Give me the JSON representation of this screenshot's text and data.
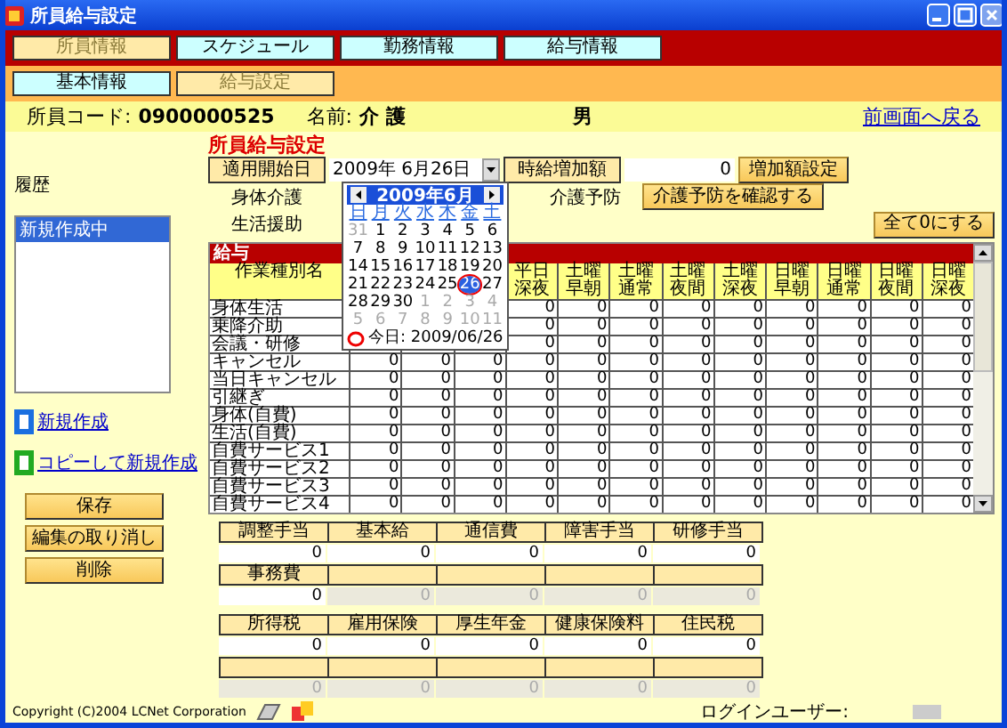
{
  "window": {
    "title": "所員給与設定"
  },
  "main_tabs": [
    {
      "label": "所員情報",
      "selected": true
    },
    {
      "label": "スケジュール",
      "selected": false
    },
    {
      "label": "勤務情報",
      "selected": false
    },
    {
      "label": "給与情報",
      "selected": false
    }
  ],
  "sub_tabs": [
    {
      "label": "基本情報",
      "selected": false
    },
    {
      "label": "給与設定",
      "selected": true
    }
  ],
  "employee": {
    "code_label": "所員コード:",
    "code": "0900000525",
    "name_label": "名前:",
    "name": "介 護",
    "gender": "男",
    "back_link": "前画面へ戻る"
  },
  "history": {
    "label": "履歴",
    "items": [
      {
        "label": "新規作成中",
        "selected": true
      }
    ]
  },
  "actions": [
    {
      "label": "新規作成",
      "kind": "new"
    },
    {
      "label": "コピーして新規作成",
      "kind": "copy"
    }
  ],
  "buttons": [
    "保存",
    "編集の取り消し",
    "削除"
  ],
  "form": {
    "title": "所員給与設定",
    "start_date_label": "適用開始日",
    "start_date": "2009年 6月26日",
    "hourly_label": "時給増加額",
    "hourly_value": "0",
    "hourly_button": "増加額設定",
    "care_label": "身体介護",
    "prevention_label": "介護予防",
    "prevention_button": "介護予防を確認する",
    "life_label": "生活援助",
    "zero_button": "全て0にする"
  },
  "calendar": {
    "month": "2009年6月",
    "weekdays": [
      "日",
      "月",
      "火",
      "水",
      "木",
      "金",
      "土"
    ],
    "weeks": [
      [
        {
          "day": "31",
          "current": false,
          "selected": false
        },
        {
          "day": "1",
          "current": true,
          "selected": false
        },
        {
          "day": "2",
          "current": true,
          "selected": false
        },
        {
          "day": "3",
          "current": true,
          "selected": false
        },
        {
          "day": "4",
          "current": true,
          "selected": false
        },
        {
          "day": "5",
          "current": true,
          "selected": false
        },
        {
          "day": "6",
          "current": true,
          "selected": false
        }
      ],
      [
        {
          "day": "7",
          "current": true,
          "selected": false
        },
        {
          "day": "8",
          "current": true,
          "selected": false
        },
        {
          "day": "9",
          "current": true,
          "selected": false
        },
        {
          "day": "10",
          "current": true,
          "selected": false
        },
        {
          "day": "11",
          "current": true,
          "selected": false
        },
        {
          "day": "12",
          "current": true,
          "selected": false
        },
        {
          "day": "13",
          "current": true,
          "selected": false
        }
      ],
      [
        {
          "day": "14",
          "current": true,
          "selected": false
        },
        {
          "day": "15",
          "current": true,
          "selected": false
        },
        {
          "day": "16",
          "current": true,
          "selected": false
        },
        {
          "day": "17",
          "current": true,
          "selected": false
        },
        {
          "day": "18",
          "current": true,
          "selected": false
        },
        {
          "day": "19",
          "current": true,
          "selected": false
        },
        {
          "day": "20",
          "current": true,
          "selected": false
        }
      ],
      [
        {
          "day": "21",
          "current": true,
          "selected": false
        },
        {
          "day": "22",
          "current": true,
          "selected": false
        },
        {
          "day": "23",
          "current": true,
          "selected": false
        },
        {
          "day": "24",
          "current": true,
          "selected": false
        },
        {
          "day": "25",
          "current": true,
          "selected": false
        },
        {
          "day": "26",
          "current": true,
          "selected": true
        },
        {
          "day": "27",
          "current": true,
          "selected": false
        }
      ],
      [
        {
          "day": "28",
          "current": true,
          "selected": false
        },
        {
          "day": "29",
          "current": true,
          "selected": false
        },
        {
          "day": "30",
          "current": true,
          "selected": false
        },
        {
          "day": "1",
          "current": false,
          "selected": false
        },
        {
          "day": "2",
          "current": false,
          "selected": false
        },
        {
          "day": "3",
          "current": false,
          "selected": false
        },
        {
          "day": "4",
          "current": false,
          "selected": false
        }
      ],
      [
        {
          "day": "5",
          "current": false,
          "selected": false
        },
        {
          "day": "6",
          "current": false,
          "selected": false
        },
        {
          "day": "7",
          "current": false,
          "selected": false
        },
        {
          "day": "8",
          "current": false,
          "selected": false
        },
        {
          "day": "9",
          "current": false,
          "selected": false
        },
        {
          "day": "10",
          "current": false,
          "selected": false
        },
        {
          "day": "11",
          "current": false,
          "selected": false
        }
      ]
    ],
    "today_label": "今日: 2009/06/26"
  },
  "pay_table": {
    "title": "給与",
    "columns": [
      "作業種別名",
      "平日深夜",
      "土曜早朝",
      "土曜通常",
      "土曜夜間",
      "土曜深夜",
      "日曜早朝",
      "日曜通常",
      "日曜夜間",
      "日曜深夜"
    ],
    "rows": [
      {
        "name": "身体生活",
        "values": [
          "0",
          "0",
          "0",
          "0",
          "0",
          "0",
          "0",
          "0",
          "0"
        ]
      },
      {
        "name": "乗降介助",
        "values": [
          "0",
          "0",
          "0",
          "0",
          "0",
          "0",
          "0",
          "0",
          "0"
        ]
      },
      {
        "name": "会議・研修",
        "values": [
          "0",
          "0",
          "0",
          "0",
          "0",
          "0",
          "0",
          "0",
          "0"
        ]
      },
      {
        "name": "キャンセル",
        "values": [
          "0",
          "0",
          "0",
          "0",
          "0",
          "0",
          "0",
          "0",
          "0",
          "0",
          "0",
          "0"
        ]
      },
      {
        "name": "当日キャンセル",
        "values": [
          "0",
          "0",
          "0",
          "0",
          "0",
          "0",
          "0",
          "0",
          "0",
          "0",
          "0",
          "0"
        ]
      },
      {
        "name": "引継ぎ",
        "values": [
          "0",
          "0",
          "0",
          "0",
          "0",
          "0",
          "0",
          "0",
          "0",
          "0",
          "0",
          "0"
        ]
      },
      {
        "name": "身体(自費)",
        "values": [
          "0",
          "0",
          "0",
          "0",
          "0",
          "0",
          "0",
          "0",
          "0",
          "0",
          "0",
          "0"
        ]
      },
      {
        "name": "生活(自費)",
        "values": [
          "0",
          "0",
          "0",
          "0",
          "0",
          "0",
          "0",
          "0",
          "0",
          "0",
          "0",
          "0"
        ]
      },
      {
        "name": "自費サービス1",
        "values": [
          "0",
          "0",
          "0",
          "0",
          "0",
          "0",
          "0",
          "0",
          "0",
          "0",
          "0",
          "0"
        ]
      },
      {
        "name": "自費サービス2",
        "values": [
          "0",
          "0",
          "0",
          "0",
          "0",
          "0",
          "0",
          "0",
          "0",
          "0",
          "0",
          "0"
        ]
      },
      {
        "name": "自費サービス3",
        "values": [
          "0",
          "0",
          "0",
          "0",
          "0",
          "0",
          "0",
          "0",
          "0",
          "0",
          "0",
          "0"
        ]
      },
      {
        "name": "自費サービス4",
        "values": [
          "0",
          "0",
          "0",
          "0",
          "0",
          "0",
          "0",
          "0",
          "0",
          "0",
          "0",
          "0"
        ]
      }
    ]
  },
  "allowances": [
    [
      {
        "header": "調整手当",
        "value": "0",
        "disabled": false
      },
      {
        "header": "基本給",
        "value": "0",
        "disabled": false
      },
      {
        "header": "通信費",
        "value": "0",
        "disabled": false
      },
      {
        "header": "障害手当",
        "value": "0",
        "disabled": false
      },
      {
        "header": "研修手当",
        "value": "0",
        "disabled": false
      }
    ],
    [
      {
        "header": "事務費",
        "value": "0",
        "disabled": false
      },
      {
        "value": "0",
        "disabled": true
      },
      {
        "value": "0",
        "disabled": true
      },
      {
        "value": "0",
        "disabled": true
      },
      {
        "value": "0",
        "disabled": true
      }
    ]
  ],
  "deductions": [
    [
      {
        "header": "所得税",
        "value": "0",
        "disabled": false
      },
      {
        "header": "雇用保険",
        "value": "0",
        "disabled": false
      },
      {
        "header": "厚生年金",
        "value": "0",
        "disabled": false
      },
      {
        "header": "健康保険料",
        "value": "0",
        "disabled": false
      },
      {
        "header": "住民税",
        "value": "0",
        "disabled": false
      }
    ],
    [
      {
        "value": "0",
        "disabled": true
      },
      {
        "value": "0",
        "disabled": true
      },
      {
        "value": "0",
        "disabled": true
      },
      {
        "value": "0",
        "disabled": true
      },
      {
        "value": "0",
        "disabled": true
      }
    ]
  ],
  "footer": {
    "copyright": "Copyright (C)2004 LCNet Corporation",
    "login_label": "ログインユーザー:"
  }
}
